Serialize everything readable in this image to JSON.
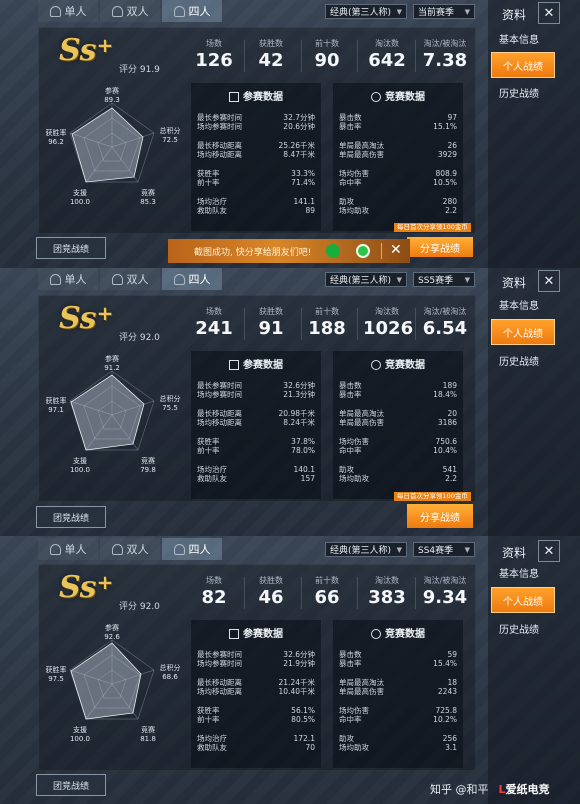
{
  "tabs": [
    "单人",
    "双人",
    "四人"
  ],
  "side": {
    "title": "资料",
    "close": "✕",
    "items": [
      "基本信息",
      "个人战绩",
      "历史战绩"
    ]
  },
  "labels": {
    "stats": [
      "场数",
      "获胜数",
      "前十数",
      "淘汰数",
      "淘汰/被淘汰"
    ],
    "section_left": "参赛数据",
    "section_right": "竞赛数据",
    "radar": [
      "参赛",
      "总积分",
      "竞赛",
      "支援",
      "获胜率"
    ],
    "left_rows": [
      "最长参赛时间",
      "场均参赛时间",
      "最长移动距离",
      "场均移动距离",
      "获胜率",
      "前十率",
      "场均治疗",
      "救助队友"
    ],
    "right_rows": [
      "暴击数",
      "暴击率",
      "单局最高淘汰",
      "单局最高伤害",
      "场均伤害",
      "命中率",
      "助攻",
      "场均助攻"
    ],
    "team_btn": "团竞战绩",
    "share_btn": "分享战绩",
    "reward": "每日首次分享领100金币"
  },
  "panels": [
    {
      "mode": "经典(第三人称)",
      "season": "当前赛季",
      "grade": "Ss",
      "rating": "评分 91.9",
      "stats": [
        "126",
        "42",
        "90",
        "642",
        "7.38"
      ],
      "radar": [
        "89.3",
        "72.5",
        "85.3",
        "100.0",
        "96.2"
      ],
      "left": [
        "32.7分钟",
        "20.6分钟",
        "25.26千米",
        "8.47千米",
        "33.3%",
        "71.4%",
        "141.1",
        "89"
      ],
      "right": [
        "97",
        "15.1%",
        "26",
        "3929",
        "808.9",
        "10.5%",
        "280",
        "2.2"
      ]
    },
    {
      "mode": "经典(第三人称)",
      "season": "SS5赛季",
      "grade": "Ss",
      "rating": "评分 92.0",
      "stats": [
        "241",
        "91",
        "188",
        "1026",
        "6.54"
      ],
      "radar": [
        "91.2",
        "75.5",
        "79.8",
        "100.0",
        "97.1"
      ],
      "left": [
        "32.6分钟",
        "21.3分钟",
        "20.98千米",
        "8.24千米",
        "37.8%",
        "78.0%",
        "140.1",
        "157"
      ],
      "right": [
        "189",
        "18.4%",
        "20",
        "3186",
        "750.6",
        "10.4%",
        "541",
        "2.2"
      ]
    },
    {
      "mode": "经典(第三人称)",
      "season": "SS4赛季",
      "grade": "Ss",
      "rating": "评分 92.0",
      "stats": [
        "82",
        "46",
        "66",
        "383",
        "9.34"
      ],
      "radar": [
        "92.6",
        "68.6",
        "81.8",
        "100.0",
        "97.5"
      ],
      "left": [
        "32.6分钟",
        "21.9分钟",
        "21.24千米",
        "10.40千米",
        "56.1%",
        "80.5%",
        "172.1",
        "70"
      ],
      "right": [
        "59",
        "15.4%",
        "18",
        "2243",
        "725.8",
        "10.2%",
        "256",
        "3.1"
      ]
    }
  ],
  "toast": {
    "text": "截图成功, 快分享给朋友们吧!",
    "close": "✕"
  },
  "watermark": {
    "handle": "知乎 @和平",
    "site_prefix": "L",
    "site_name": "爱纸电竞"
  }
}
